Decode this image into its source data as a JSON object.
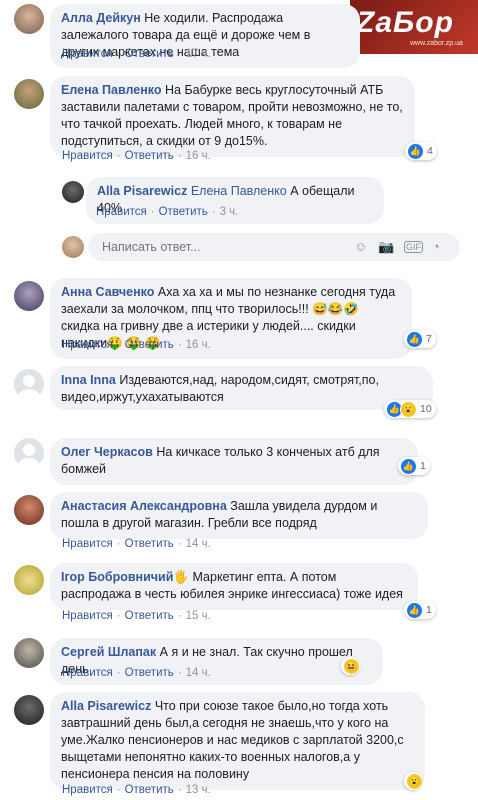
{
  "watermark": {
    "logo": "ZaБор",
    "url": "www.zabor.zp.ua"
  },
  "actions": {
    "like": "Нравится",
    "reply": "Ответить"
  },
  "reply_box": {
    "placeholder": "Написать ответ..."
  },
  "comments": [
    {
      "name": "Алла Дейкун",
      "text": "Не ходили. Распродажа залежалого товара да ещё и дороже чем в других маркетах не наша тема",
      "time": "17 ч."
    },
    {
      "name": "Елена Павленко",
      "text": "На Бабурке весь круглосуточный АТБ заставили палетами с товаром, пройти невозможно, не то, что тачкой проехать. Людей много, к товарам не подступиться, а скидки от 9 до15%.",
      "time": "16 ч.",
      "reaction_count": "4"
    },
    {
      "name": "Alla Pisarewicz",
      "mention": "Елена Павленко",
      "text": "А обещали 40%",
      "time": "3 ч."
    },
    {
      "name": "Анна Савченко",
      "text": "Аха ха ха и мы по незнанке сегодня туда заехали за молочком, ппц что творилось!!! 😅😂🤣 скидка на гривну две а истерики у людей.... скидки накидки🤑 🤑 🤑",
      "time": "16 ч.",
      "reaction_count": "7"
    },
    {
      "name": "Inna Inna",
      "text": "Издеваются,над, народом,сидят, смотрят,по, видео,иржут,ухахатываются",
      "reaction_count": "10"
    },
    {
      "name": "Олег Черкасов",
      "text": "На кичкасе только 3 конченых атб для бомжей",
      "reaction_count": "1"
    },
    {
      "name": "Анастасия Александровна",
      "text": "Зашла увидела дурдом и пошла в другой магазин. Гребли все подряд",
      "time": "14 ч."
    },
    {
      "name": "Ігор Бобровничий",
      "badge": "🖐",
      "text": "Маркетинг епта. А потом распродажа в честь юбилея энрике ингессиаса) тоже идея",
      "time": "15 ч.",
      "reaction_count": "1"
    },
    {
      "name": "Сергей Шлапак",
      "text": "А я и не знал. Так скучно прошел день",
      "time": "14 ч."
    },
    {
      "name": "Alla Pisarewicz",
      "text": "Что при союзе такое было,но тогда хоть завтрашний день был,а сегодня не знаешь,что у кого на уме.Жалко пенсионеров и нас медиков с зарплатой 3200,с выщетами непонятно каких-то военных налогов,а у пенсионера пенсия на половину",
      "time": "13 ч."
    }
  ]
}
